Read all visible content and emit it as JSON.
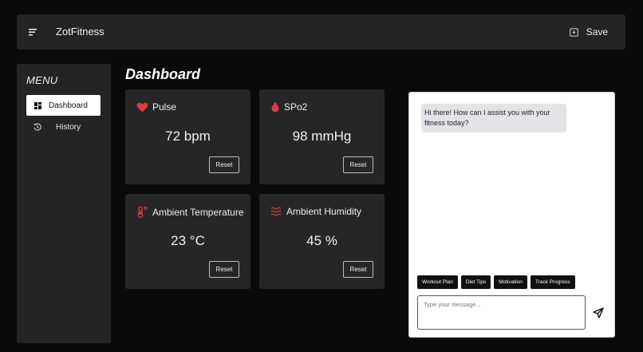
{
  "header": {
    "title": "ZotFitness",
    "save_label": "Save"
  },
  "sidebar": {
    "menu_title": "MENU",
    "items": [
      {
        "label": "Dashboard",
        "icon": "dashboard-icon",
        "active": true
      },
      {
        "label": "History",
        "icon": "history-icon",
        "active": false
      }
    ]
  },
  "main": {
    "title": "Dashboard",
    "cards": [
      {
        "label": "Pulse",
        "value": "72 bpm",
        "icon": "heart-icon",
        "reset_label": "Reset"
      },
      {
        "label": "SPo2",
        "value": "98 mmHg",
        "icon": "droplet-icon",
        "reset_label": "Reset"
      },
      {
        "label": "Ambient Temperature",
        "value": "23 °C",
        "icon": "thermometer-icon",
        "reset_label": "Reset"
      },
      {
        "label": "Ambient Humidity",
        "value": "45 %",
        "icon": "humidity-icon",
        "reset_label": "Reset"
      }
    ]
  },
  "chat": {
    "message": "Hi there! How can I assist you with your fitness today?",
    "quick_replies": [
      "Workout Plan",
      "Diet Tips",
      "Motivation",
      "Track Progress"
    ],
    "input_placeholder": "Type your message...",
    "input_value": ""
  },
  "colors": {
    "accent": "#e23b3b",
    "background": "#0a0a0a",
    "panel": "#242424",
    "card": "#262626"
  }
}
